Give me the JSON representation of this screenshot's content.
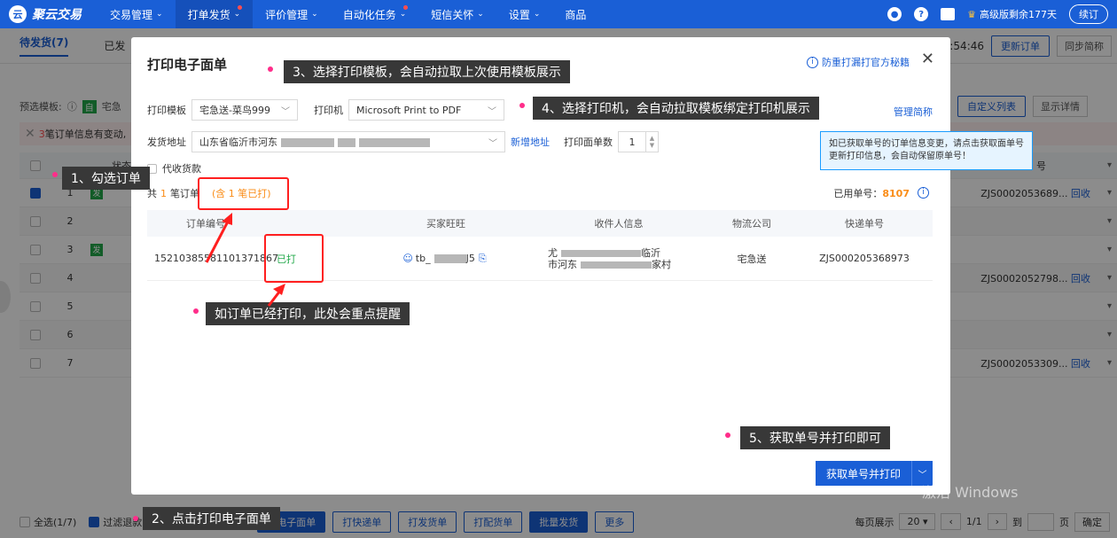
{
  "nav": {
    "logo": "聚云交易",
    "items": [
      {
        "label": "交易管理",
        "caret": true,
        "dot": false,
        "active": false
      },
      {
        "label": "打单发货",
        "caret": true,
        "dot": true,
        "active": true
      },
      {
        "label": "评价管理",
        "caret": true,
        "dot": false,
        "active": false
      },
      {
        "label": "自动化任务",
        "caret": true,
        "dot": true,
        "active": false
      },
      {
        "label": "短信关怀",
        "caret": true,
        "dot": false,
        "active": false
      },
      {
        "label": "设置",
        "caret": true,
        "dot": false,
        "active": false
      },
      {
        "label": "商品",
        "caret": false,
        "dot": false,
        "active": false
      }
    ],
    "vip_text": "高级版剩余177天",
    "renew": "续订"
  },
  "page": {
    "tab_pending": "待发货(7)",
    "tab_shipped": "已发",
    "time": ":54:46",
    "update_order": "更新订单",
    "sync_note": "同步简称",
    "custom_list": "自定义列表",
    "show_detail": "显示详情",
    "preset_label": "预选模板:",
    "preset_tag": "自",
    "preset_short": "宅急",
    "warn_count": "3",
    "warn_text": "笔订单信息有变动,",
    "table_head_status": "状态",
    "table_head_express": "号",
    "rows": [
      {
        "num": "1",
        "tag": "发",
        "express": "ZJS0002053689...",
        "link": "回收",
        "checked": true
      },
      {
        "num": "2",
        "tag": "",
        "express": "",
        "link": "",
        "checked": false
      },
      {
        "num": "3",
        "tag": "发",
        "express": "",
        "link": "",
        "checked": false
      },
      {
        "num": "4",
        "tag": "",
        "express": "ZJS0002052798...",
        "link": "回收",
        "checked": false
      },
      {
        "num": "5",
        "tag": "",
        "express": "",
        "link": "",
        "checked": false
      },
      {
        "num": "6",
        "tag": "",
        "express": "",
        "link": "",
        "checked": false
      },
      {
        "num": "7",
        "tag": "",
        "express": "ZJS0002053309...",
        "link": "回收",
        "checked": false
      }
    ],
    "footer": {
      "select_all": "全选(1/7)",
      "filter": "过滤退款",
      "btn_print_ewaybill": "打电子面单",
      "btn_print_express": "打快递单",
      "btn_print_ship": "打发货单",
      "btn_print_pick": "打配货单",
      "btn_batch_ship": "批量发货",
      "btn_more": "更多",
      "per_page_label": "每页展示",
      "per_page": "20",
      "page_info": "1/1",
      "goto_label": "到",
      "page_unit": "页",
      "confirm": "确定"
    },
    "watermark": "激活 Windows"
  },
  "modal": {
    "title": "打印电子面单",
    "tip_link": "防重打漏打官方秘籍",
    "template_label": "打印模板",
    "template_value": "宅急送-菜鸟999",
    "printer_label": "打印机",
    "printer_value": "Microsoft Print to PDF",
    "manage_short": "管理简称",
    "sender_label": "发货地址",
    "sender_value": "山东省临沂市河东",
    "new_address": "新增地址",
    "copies_label": "打印面单数",
    "copies_value": "1",
    "cod_label": "代收货款",
    "summary_prefix": "共",
    "summary_count": "1",
    "summary_unit": "笔订单",
    "summary_printed": "(含 1 笔已打)",
    "used_label": "已用单号：",
    "used_value": "8107",
    "columns": [
      "订单编号",
      "买家旺旺",
      "收件人信息",
      "物流公司",
      "快递单号"
    ],
    "order": {
      "order_no": "15210385581101371867",
      "printed": "已打",
      "buyer": "tb_",
      "buyer_suffix": "J5",
      "addr1": "尤",
      "addr1_tail": "临沂",
      "addr2": "市河东",
      "addr2_tail": "家村",
      "logistics": "宅急送",
      "tracking": "ZJS000205368973"
    },
    "submit": "获取单号并打印"
  },
  "tooltip": "如已获取单号的订单信息变更，请点击获取面单号更新打印信息，会自动保留原单号！",
  "callouts": {
    "step1": "1、勾选订单",
    "step2": "2、点击打印电子面单",
    "step3": "3、选择打印模板，会自动拉取上次使用模板展示",
    "step4": "4、选择打印机，会自动拉取模板绑定打印机展示",
    "step5": "5、获取单号并打印即可",
    "printed_note": "如订单已经打印，此处会重点提醒"
  },
  "colors": {
    "brand": "#1a5fd6",
    "printed": "#22a84a",
    "highlight": "#ff1f1f",
    "callout_bg": "#383838"
  }
}
